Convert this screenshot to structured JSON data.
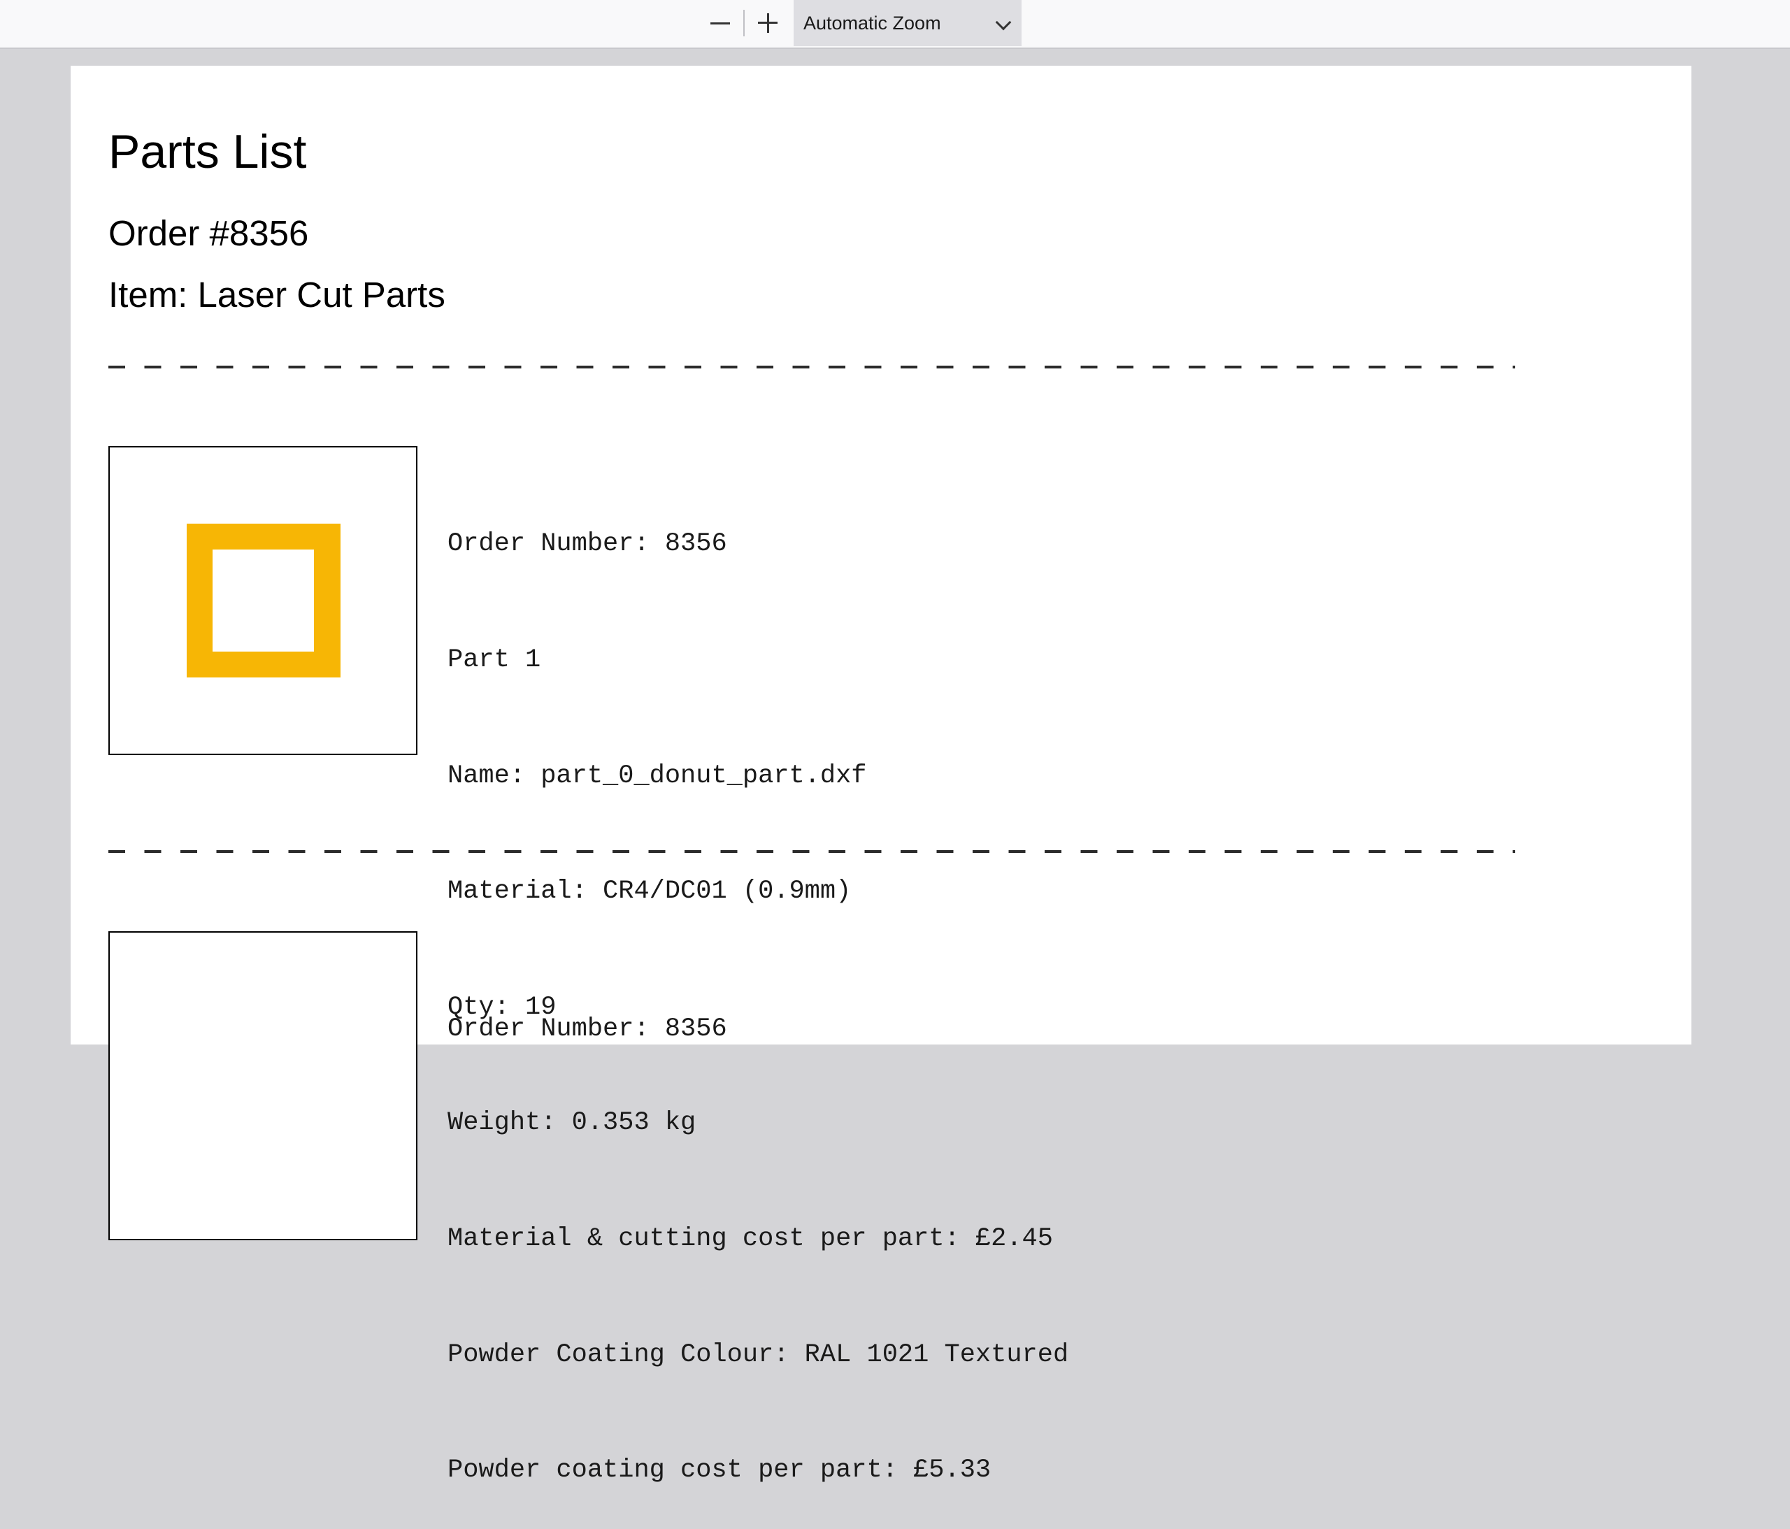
{
  "toolbar": {
    "zoom_out_icon": "minus-icon",
    "zoom_in_icon": "plus-icon",
    "zoom_value": "Automatic Zoom",
    "dropdown_icon": "chevron-down-icon"
  },
  "document": {
    "title": "Parts List",
    "order": "Order #8356",
    "item": "Item: Laser Cut Parts",
    "parts": [
      {
        "thumbnail_color": "#f7b605",
        "lines": [
          "Order Number: 8356",
          "Part 1",
          "Name: part_0_donut_part.dxf",
          "Material: CR4/DC01 (0.9mm)",
          "Qty: 19",
          "Weight: 0.353 kg",
          "Material & cutting cost per part: £2.45",
          "Powder Coating Colour: RAL 1021 Textured",
          "Powder coating cost per part: £5.33"
        ]
      },
      {
        "lines": [
          "Order Number: 8356"
        ]
      }
    ]
  }
}
